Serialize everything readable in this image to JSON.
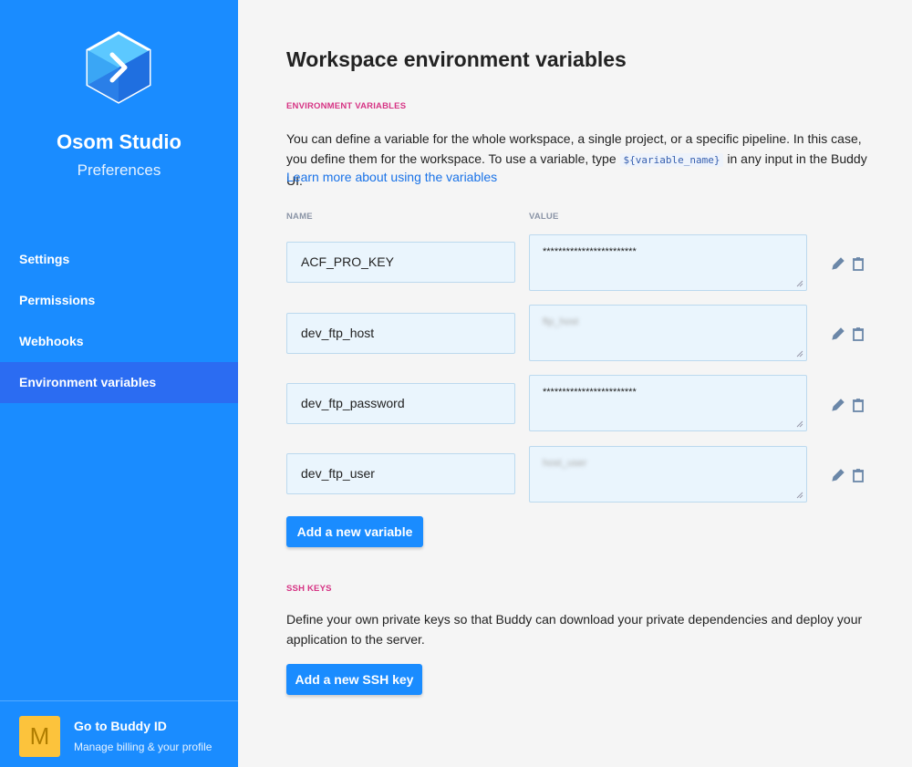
{
  "sidebar": {
    "org_name": "Osom Studio",
    "subtitle": "Preferences",
    "nav": [
      {
        "label": "Settings"
      },
      {
        "label": "Permissions"
      },
      {
        "label": "Webhooks"
      },
      {
        "label": "Environment variables",
        "active": true
      }
    ],
    "profile": {
      "avatar_letter": "M",
      "title": "Go to Buddy ID",
      "subtitle": "Manage billing & your profile"
    }
  },
  "main": {
    "title": "Workspace environment variables",
    "env_section": {
      "label": "ENVIRONMENT VARIABLES",
      "desc_before": "You can define a variable for the whole workspace, a single project, or a specific pipeline. In this case, you define them for the workspace. To use a variable, type ",
      "code": "${variable_name}",
      "desc_after": " in any input in the Buddy UI.",
      "learn_more": "Learn more about using the variables",
      "col_name": "NAME",
      "col_value": "VALUE",
      "variables": [
        {
          "name": "ACF_PRO_KEY",
          "value": "************************",
          "masked": true
        },
        {
          "name": "dev_ftp_host",
          "value": "ftp_host",
          "masked": false
        },
        {
          "name": "dev_ftp_password",
          "value": "************************",
          "masked": true
        },
        {
          "name": "dev_ftp_user",
          "value": "host_user",
          "masked": false
        }
      ],
      "add_button": "Add a new variable"
    },
    "ssh_section": {
      "label": "SSH KEYS",
      "desc": "Define your own private keys so that Buddy can download your private dependencies and deploy your application to the server.",
      "add_button": "Add a new SSH key"
    }
  },
  "colors": {
    "sidebar_bg": "#1a8cff",
    "active_nav": "#2b6cf2",
    "accent": "#1a8cff",
    "section_label": "#d63384",
    "avatar": "#fcc33c"
  }
}
